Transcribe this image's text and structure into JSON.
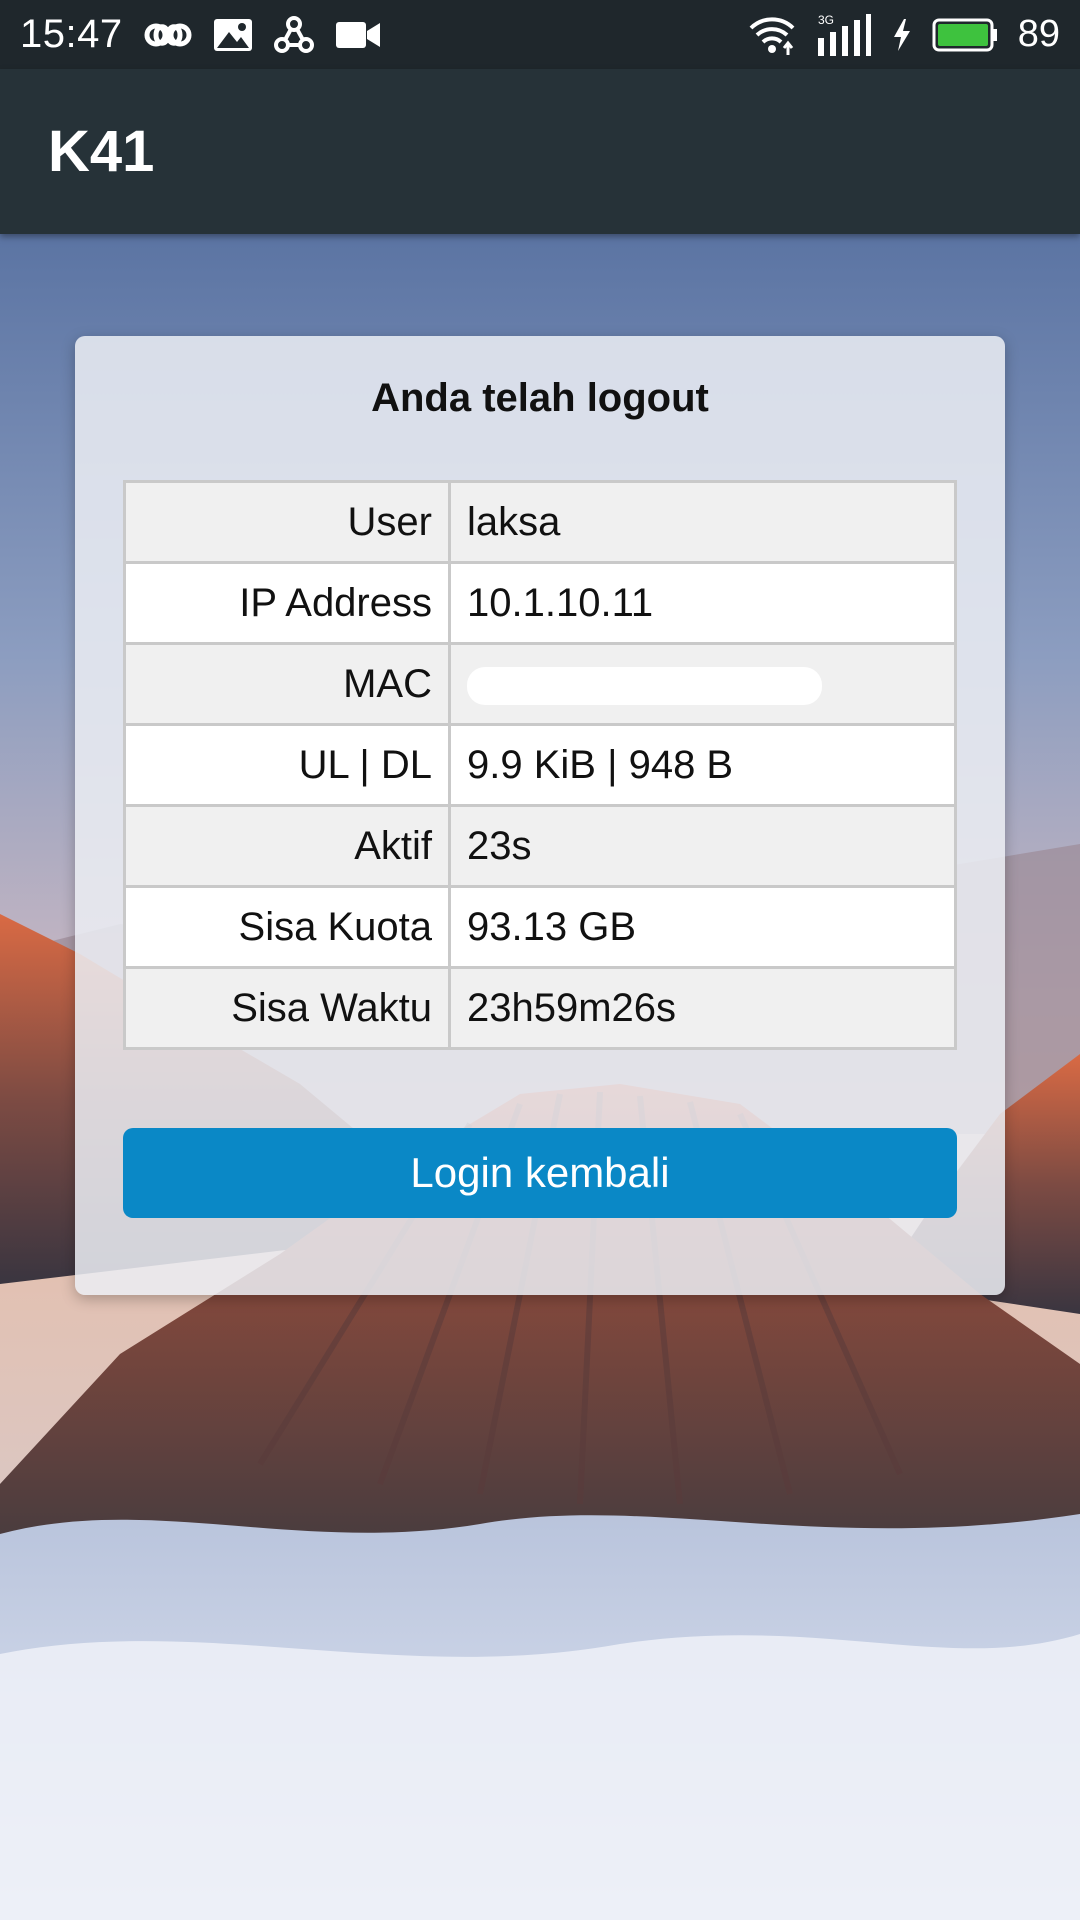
{
  "status_bar": {
    "time": "15:47",
    "battery_level": "89",
    "network_type": "3G",
    "icons": [
      "infinity-icon",
      "image-icon",
      "share-icon",
      "video-camera-icon",
      "wifi-icon",
      "signal-icon",
      "charging-icon",
      "battery-icon"
    ],
    "battery_color": "#3ec23e"
  },
  "app_bar": {
    "title": "K41",
    "color": "#263238"
  },
  "card": {
    "title": "Anda telah logout",
    "rows": [
      {
        "label": "User",
        "value": "laksa"
      },
      {
        "label": "IP Address",
        "value": "10.1.10.11"
      },
      {
        "label": "MAC",
        "value": ""
      },
      {
        "label": "UL | DL",
        "value": "9.9 KiB | 948 B"
      },
      {
        "label": "Aktif",
        "value": "23s"
      },
      {
        "label": "Sisa Kuota",
        "value": "93.13 GB"
      },
      {
        "label": "Sisa Waktu",
        "value": "23h59m26s"
      }
    ],
    "button_label": "Login kembali",
    "button_color": "#0a88c6"
  }
}
